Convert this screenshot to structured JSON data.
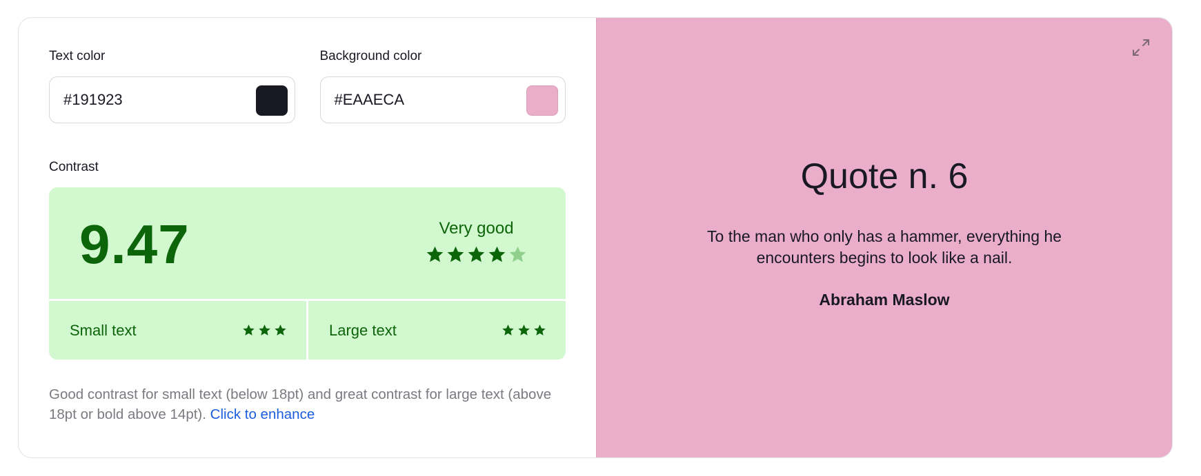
{
  "text_color": {
    "label": "Text color",
    "value": "#191923",
    "swatch": "#191923"
  },
  "background_color": {
    "label": "Background color",
    "value": "#EAAECA",
    "swatch": "#EAAECA"
  },
  "contrast": {
    "label": "Contrast",
    "score": "9.47",
    "rating_label": "Very good",
    "rating_stars": 4,
    "rating_max": 5,
    "small_text": {
      "label": "Small text",
      "stars": 3
    },
    "large_text": {
      "label": "Large text",
      "stars": 3
    },
    "accent": "#0d6509",
    "box_bg": "#d2f8d0"
  },
  "description": {
    "text": "Good contrast for small text (below 18pt) and great contrast for large text (above 18pt or bold above 14pt).",
    "link": "Click to enhance"
  },
  "preview": {
    "expand_icon": "expand-icon",
    "title": "Quote n. 6",
    "quote": "To the man who only has a hammer, everything he encounters begins to look like a nail.",
    "author": "Abraham Maslow"
  }
}
